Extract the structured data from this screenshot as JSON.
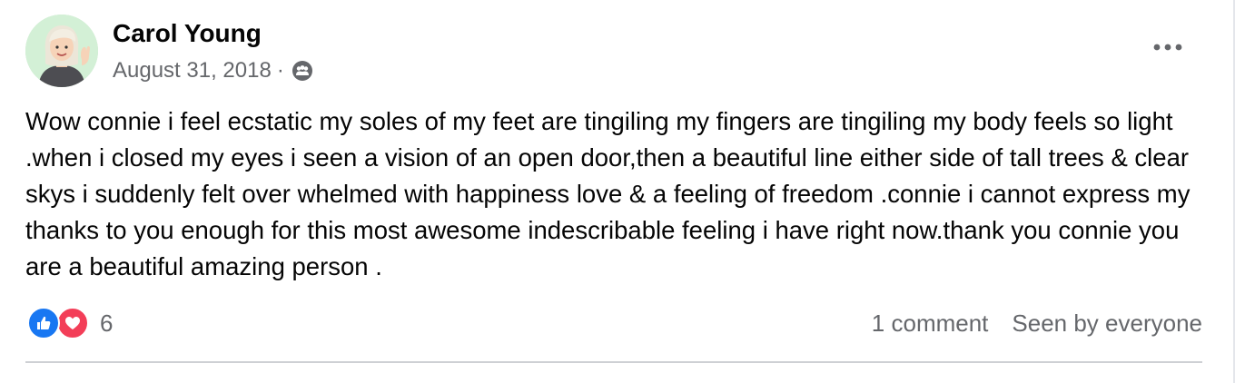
{
  "post": {
    "author": "Carol Young",
    "date": "August 31, 2018",
    "separator": "·",
    "audience_icon": "friends-group-icon",
    "more_icon": "more-options-icon",
    "text": "Wow connie i feel ecstatic my soles of my feet are tingiling my fingers are tingiling my body feels so light .when i closed my eyes i seen a vision of an open door,then a beautiful line either side of tall trees & clear skys i suddenly felt over whelmed with happiness love & a feeling of freedom .connie i cannot express my thanks to you enough for this most awesome indescribable feeling i have right now.thank you connie you are a beautiful amazing person ."
  },
  "reactions": {
    "icons": [
      "like-icon",
      "love-icon"
    ],
    "count": "6"
  },
  "stats": {
    "comments": "1 comment",
    "seen_by": "Seen by everyone"
  },
  "colors": {
    "like": "#1877f2",
    "love": "#f33e58",
    "secondary_text": "#65676b",
    "primary_text": "#050505",
    "avatar_bg": "#d3f0d6"
  }
}
